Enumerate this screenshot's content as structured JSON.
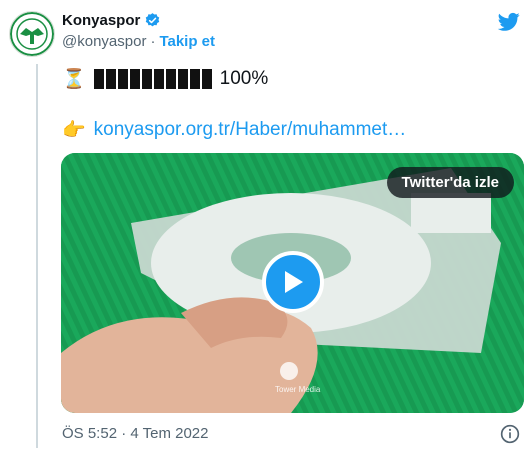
{
  "account": {
    "name": "Konyaspor",
    "handle": "@konyaspor",
    "separator": "·",
    "follow_label": "Takip et",
    "verified": true
  },
  "tweet": {
    "line1_emoji": "⏳",
    "progress_text": "100%",
    "progress_fraction": 1.0,
    "line2_emoji": "👉",
    "link_text": "konyaspor.org.tr/Haber/muhammet…"
  },
  "video": {
    "watch_label": "Twitter'da izle",
    "watermark_text": "Tower Media"
  },
  "footer": {
    "timestamp": "ÖS 5:52 · 4 Tem 2022"
  },
  "colors": {
    "accent": "#1d9bf0",
    "text": "#0f1419",
    "muted": "#536471",
    "field_green": "#18a85a"
  },
  "icons": {
    "brand": "twitter-bird-icon",
    "verified": "verified-badge-icon",
    "info": "info-icon",
    "play": "play-icon"
  }
}
